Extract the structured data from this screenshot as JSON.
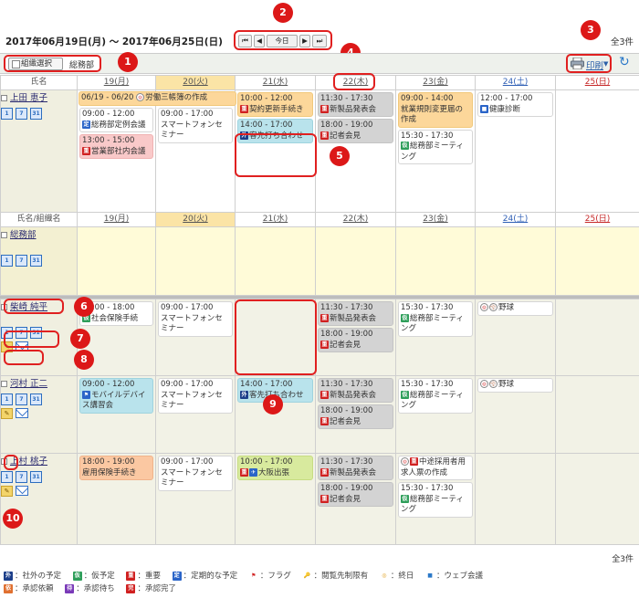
{
  "header": {
    "date_range": "2017年06月19日(月) ～ 2017年06月25日(日)",
    "total": "全3件",
    "nav": {
      "first": "⏮",
      "prev": "◀",
      "today": "今日",
      "next": "▶",
      "last": "⏭"
    }
  },
  "toolbar": {
    "org_select_label": "組織選択",
    "org_name": "総務部",
    "print_label": "印刷",
    "refresh_icon": "↻"
  },
  "days": [
    "19(月)",
    "20(火)",
    "21(水)",
    "22(木)",
    "23(金)",
    "24(土)",
    "25(日)"
  ],
  "col_headers": {
    "name": "氏名",
    "name_group": "氏名/組織名"
  },
  "callouts": [
    "1",
    "2",
    "3",
    "4",
    "5",
    "6",
    "7",
    "8",
    "9",
    "10"
  ],
  "top_user": {
    "name": "上田 恵子",
    "events": {
      "mon_span": "06/19 - 06/20",
      "mon_span_title": "労働三帳簿の作成",
      "mon_1_time": "09:00 - 12:00",
      "mon_1_title": "総務部定例会議",
      "mon_2_time": "13:00 - 15:00",
      "mon_2_title": "営業部社内会議",
      "tue_1_time": "09:00 - 17:00",
      "tue_1_title": "スマートフォンセミナー",
      "wed_1_time": "10:00 - 12:00",
      "wed_1_title": "契約更新手続き",
      "wed_2_time": "14:00 - 17:00",
      "wed_2_title": "客先打ち合わせ",
      "thu_1_time": "11:30 - 17:30",
      "thu_1_title": "新製品発表会",
      "thu_2_time": "18:00 - 19:00",
      "thu_2_title": "記者会見",
      "fri_1_time": "09:00 - 14:00",
      "fri_1_title": "就業規則変更届の作成",
      "fri_2_time": "15:30 - 17:30",
      "fri_2_title": "総務部ミーティング",
      "sat_1_time": "12:00 - 17:00",
      "sat_1_title": "健康診断"
    }
  },
  "group": {
    "name": "総務部"
  },
  "users": [
    {
      "name": "柴崎 純平",
      "mon_time": "09:00 - 18:00",
      "mon_title": "社会保険手続",
      "tue_time": "09:00 - 17:00",
      "tue_title": "スマートフォンセミナー",
      "thu_1_time": "11:30 - 17:30",
      "thu_1_title": "新製品発表会",
      "thu_2_time": "18:00 - 19:00",
      "thu_2_title": "記者会見",
      "fri_time": "15:30 - 17:30",
      "fri_title": "総務部ミーティング",
      "sat_title": "野球"
    },
    {
      "name": "河村 正二",
      "mon_time": "09:00 - 12:00",
      "mon_title": "モバイルデバイス講習会",
      "tue_time": "09:00 - 17:00",
      "tue_title": "スマートフォンセミナー",
      "wed_time": "14:00 - 17:00",
      "wed_title": "客先打ち合わせ",
      "thu_1_time": "11:30 - 17:30",
      "thu_1_title": "新製品発表会",
      "thu_2_time": "18:00 - 19:00",
      "thu_2_title": "記者会見",
      "fri_time": "15:30 - 17:30",
      "fri_title": "総務部ミーティング",
      "sat_title": "野球"
    },
    {
      "name": "上村 桃子",
      "mon_time": "18:00 - 19:00",
      "mon_title": "雇用保険手続き",
      "tue_time": "09:00 - 17:00",
      "tue_title": "スマートフォンセミナー",
      "wed_time": "10:00 - 17:00",
      "wed_title": "大阪出張",
      "thu_1_time": "11:30 - 17:30",
      "thu_1_title": "新製品発表会",
      "thu_2_time": "18:00 - 19:00",
      "thu_2_title": "記者会見",
      "fri_1_title": "中途採用者用求人票の作成",
      "fri_2_time": "15:30 - 17:30",
      "fri_2_title": "総務部ミーティング"
    }
  ],
  "footer": {
    "total": "全3件"
  },
  "legend": [
    {
      "tag": "外",
      "label": "：社外の予定",
      "color": "#1d3f8a"
    },
    {
      "tag": "仮",
      "label": "：仮予定",
      "color": "#2e9e5a"
    },
    {
      "tag": "重",
      "label": "：重要",
      "color": "#d02020"
    },
    {
      "tag": "定",
      "label": "：定期的な予定",
      "color": "#2a64c8"
    },
    {
      "tag": "⚑",
      "label": "：フラグ",
      "color": "#d02020"
    },
    {
      "tag": "🔑",
      "label": "：閲覧先制限有",
      "color": "#d02020"
    },
    {
      "tag": "◎",
      "label": "：終日",
      "color": "#e0a020"
    },
    {
      "tag": "■",
      "label": "：ウェブ会議",
      "color": "#2a78c8"
    },
    {
      "tag": "依",
      "label": "：承認依頼",
      "color": "#e07030"
    },
    {
      "tag": "待",
      "label": "：承認待ち",
      "color": "#7a3ab8"
    },
    {
      "tag": "完",
      "label": "：承認完了",
      "color": "#d02020"
    }
  ]
}
